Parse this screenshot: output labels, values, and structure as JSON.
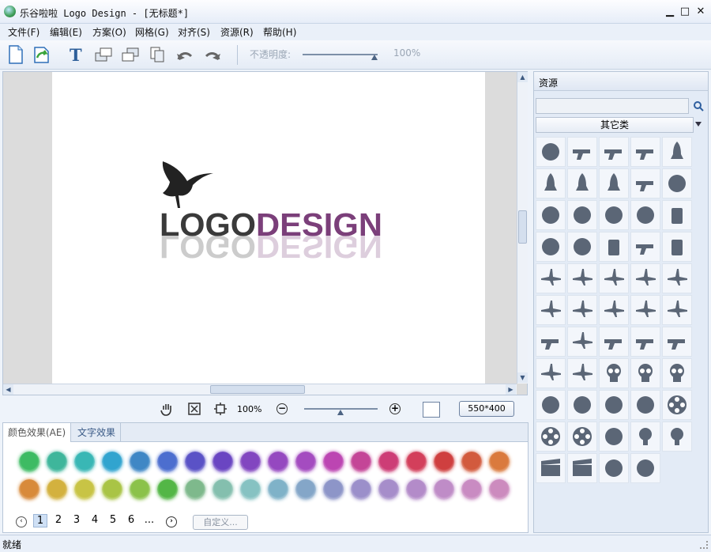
{
  "window": {
    "title": "乐谷啦啦 Logo Design - [无标题*]",
    "min": "▁",
    "max": "□",
    "close": "✕"
  },
  "menu": [
    "文件(F)",
    "编辑(E)",
    "方案(O)",
    "网格(G)",
    "对齐(S)",
    "资源(R)",
    "帮助(H)"
  ],
  "toolbar": {
    "opacity_label": "不透明度:",
    "opacity_value": "100%",
    "opacity": 1.0
  },
  "canvas": {
    "logo_text_dark": "LOGO",
    "logo_text_color": "DESIGN",
    "logo_dark_color": "#3a3a3a",
    "logo_accent_color": "#7b3f7a"
  },
  "zoom": {
    "value": "100%",
    "canvas_size": "550*400"
  },
  "effects": {
    "tabs": [
      "颜色效果(AE)",
      "文字效果"
    ],
    "row1": [
      "#3dbb63",
      "#3eb69b",
      "#39b7b5",
      "#31a4cf",
      "#3f87c5",
      "#4c6ecf",
      "#5a52c6",
      "#6a45c2",
      "#8246c0",
      "#9548c0",
      "#a44cc0",
      "#bc45b2",
      "#c44597",
      "#cd3d76",
      "#d33f5b",
      "#cf3f3f",
      "#d25a3d",
      "#da7a3d"
    ],
    "row2": [
      "#d88a3a",
      "#d3b13e",
      "#c8c445",
      "#a9c445",
      "#8bc24a",
      "#53b646",
      "#7eb98c",
      "#84bfae",
      "#86c2c2",
      "#7fb2c8",
      "#84a6c8",
      "#8d95c8",
      "#9b8fca",
      "#a68dca",
      "#b38bc9",
      "#bf8cc7",
      "#c98bc2",
      "#cc8bbe"
    ],
    "pages": [
      "1",
      "2",
      "3",
      "4",
      "5",
      "6",
      "..."
    ],
    "custom": "自定义..."
  },
  "resources": {
    "header": "资源",
    "category": "其它类",
    "icons": [
      "fan-icon",
      "pistol-icon",
      "revolver-icon",
      "handgun-icon",
      "rocket-icon",
      "missile-icon",
      "bullet-icon",
      "shell-icon",
      "launcher-icon",
      "crosshair-icon",
      "radiation-icon",
      "bomb-icon",
      "grenade-icon",
      "aerial-bomb-icon",
      "spray-icon",
      "biohazard-icon",
      "rope-icon",
      "canister-icon",
      "tank-spray-icon",
      "bottle-icon",
      "biplane-icon",
      "jet-icon",
      "fighter-icon",
      "stealth-jet-icon",
      "plane-icon",
      "biplane-2-icon",
      "jet-2-icon",
      "warplane-icon",
      "twin-prop-icon",
      "airliner-icon",
      "ship-icon",
      "airship-icon",
      "tank-icon",
      "tank-2-icon",
      "battleship-icon",
      "fighter-2-icon",
      "fighter-3-icon",
      "skull-icon",
      "skull-crossbones-icon",
      "jolly-roger-icon",
      "robot-head-icon",
      "profile-head-icon",
      "satellite-dish-icon",
      "radar-icon",
      "film-reel-icon",
      "reel-icon",
      "reel-2-icon",
      "explosion-icon",
      "bulb-icon",
      "bulb-2-icon",
      "clapper-icon",
      "clapper-2-icon",
      "tripod-icon",
      "screen-icon"
    ]
  },
  "status": {
    "text": "就绪"
  }
}
